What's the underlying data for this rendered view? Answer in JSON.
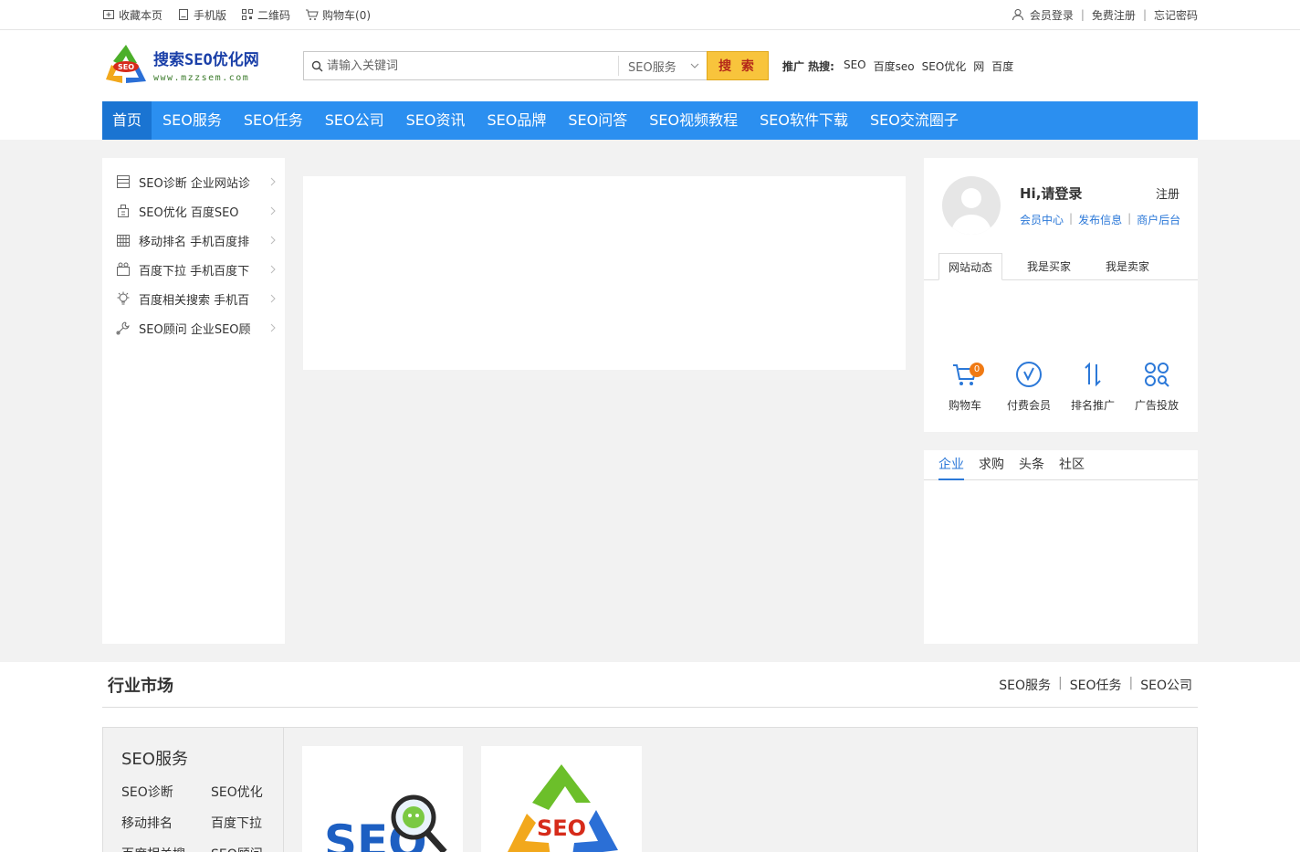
{
  "topbar": {
    "bookmark": "收藏本页",
    "mobile": "手机版",
    "qrcode": "二维码",
    "cart": "购物车(0)",
    "login": "会员登录",
    "register": "免费注册",
    "forgot": "忘记密码"
  },
  "logo": {
    "title": "搜索SEO优化网",
    "url_text": "www.mzzsem.com",
    "badge": "SEO"
  },
  "search": {
    "placeholder": "请输入关键词",
    "category": "SEO服务",
    "button": "搜 索"
  },
  "hot": {
    "label": "推广 热搜:",
    "words": [
      "SEO",
      "百度seo",
      "SEO优化",
      "网",
      "百度"
    ]
  },
  "nav": {
    "items": [
      "首页",
      "SEO服务",
      "SEO任务",
      "SEO公司",
      "SEO资讯",
      "SEO品牌",
      "SEO问答",
      "SEO视频教程",
      "SEO软件下载",
      "SEO交流圈子"
    ]
  },
  "categories": [
    {
      "label": "SEO诊断 企业网站诊",
      "icon": "archive-icon"
    },
    {
      "label": "SEO优化 百度SEO",
      "icon": "building-icon"
    },
    {
      "label": "移动排名 手机百度排",
      "icon": "calendar-icon"
    },
    {
      "label": "百度下拉 手机百度下",
      "icon": "camera-icon"
    },
    {
      "label": "百度相关搜索 手机百",
      "icon": "bulb-icon"
    },
    {
      "label": "SEO顾问 企业SEO顾",
      "icon": "wrench-icon"
    }
  ],
  "user": {
    "greeting": "Hi,请登录",
    "register": "注册",
    "links": [
      "会员中心",
      "发布信息",
      "商户后台"
    ],
    "tabs": [
      "网站动态",
      "我是买家",
      "我是卖家"
    ],
    "quick": [
      {
        "label": "购物车",
        "badge": "0"
      },
      {
        "label": "付费会员"
      },
      {
        "label": "排名推广"
      },
      {
        "label": "广告投放"
      }
    ]
  },
  "news": {
    "tabs": [
      "企业",
      "求购",
      "头条",
      "社区"
    ]
  },
  "industry": {
    "title": "行业市场",
    "links": [
      "SEO服务",
      "SEO任务",
      "SEO公司"
    ],
    "side_title": "SEO服务",
    "side_items": [
      "SEO诊断",
      "SEO优化",
      "移动排名",
      "百度下拉",
      "百度相关搜",
      "SEO顾问"
    ],
    "product_texts": [
      "SEO",
      "SEO"
    ]
  },
  "colors": {
    "nav": "#2b8ff0",
    "nav_active": "#1a74d2",
    "link": "#2b78d8",
    "search_button": "#f8c43c",
    "badge": "#f07a14"
  }
}
